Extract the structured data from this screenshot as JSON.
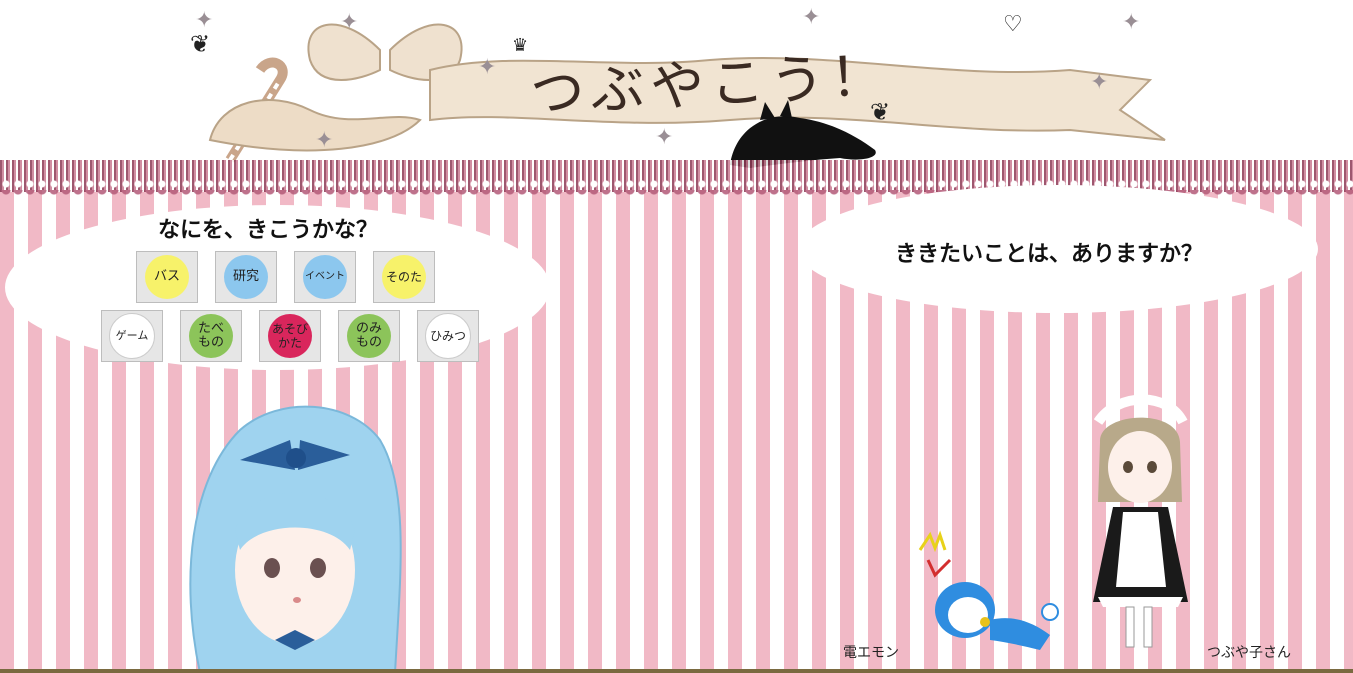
{
  "header": {
    "title": "つぶやこう！"
  },
  "left_bubble": {
    "prompt": "なにを、きこうかな？",
    "row1": [
      {
        "label": "バス",
        "color": "#f7f26a"
      },
      {
        "label": "研究",
        "color": "#8cc7ee"
      },
      {
        "label": "イベント",
        "color": "#8cc7ee"
      },
      {
        "label": "そのた",
        "color": "#f7f26a"
      }
    ],
    "row2": [
      {
        "label": "ゲーム",
        "color": "#ffffff"
      },
      {
        "label": "たべ\nもの",
        "color": "#8cc45a"
      },
      {
        "label": "あそび\nかた",
        "color": "#d9265c"
      },
      {
        "label": "のみ\nもの",
        "color": "#8cc45a"
      },
      {
        "label": "ひみつ",
        "color": "#ffffff"
      }
    ]
  },
  "right_bubble": {
    "prompt": "ききたいことは、ありますか？"
  },
  "characters": {
    "robot_name": "電エモン",
    "maid_name": "つぶや子さん"
  }
}
